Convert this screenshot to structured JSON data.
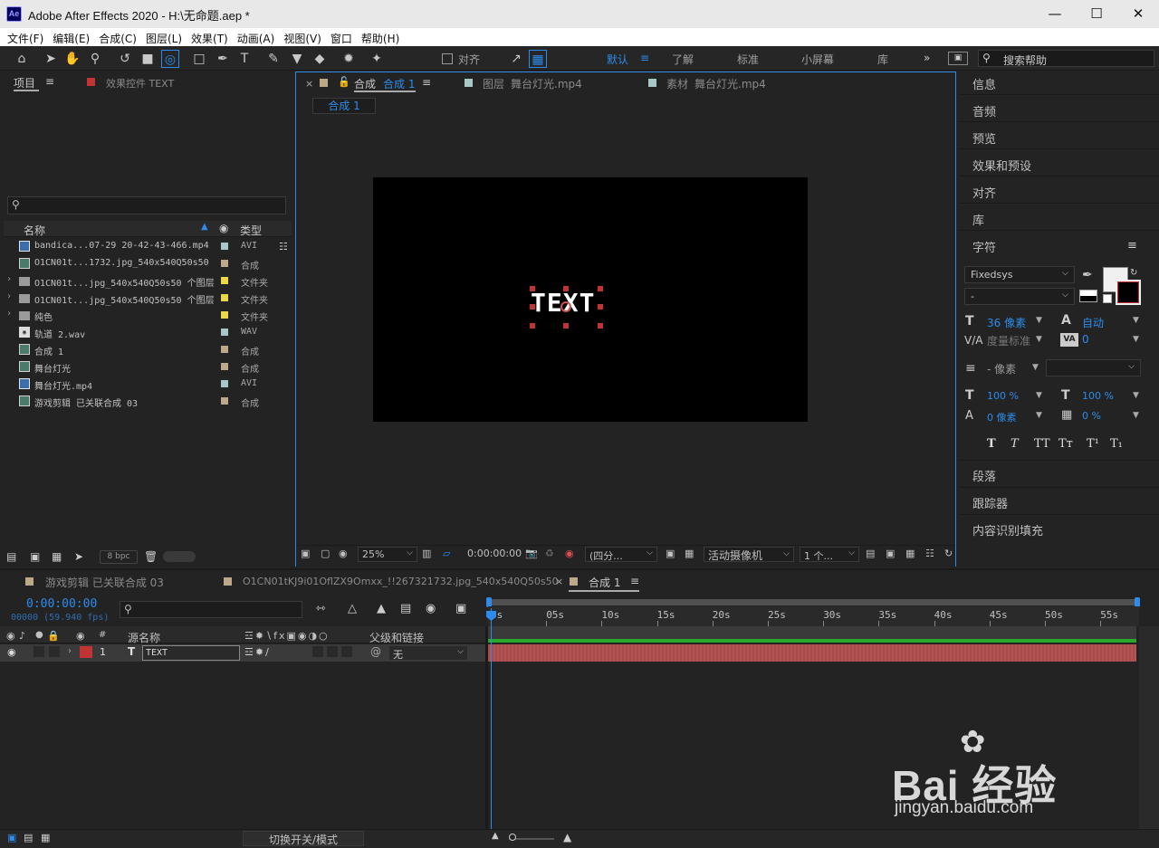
{
  "window": {
    "title": "Adobe After Effects 2020 - H:\\无命题.aep *",
    "logo": "Ae"
  },
  "menu": [
    "文件(F)",
    "编辑(E)",
    "合成(C)",
    "图层(L)",
    "效果(T)",
    "动画(A)",
    "视图(V)",
    "窗口",
    "帮助(H)"
  ],
  "toolbar": {
    "snap_label": "对齐",
    "workspaces": [
      "默认",
      "了解",
      "标准",
      "小屏幕",
      "库"
    ],
    "active_workspace": "默认",
    "search_placeholder": "搜索帮助"
  },
  "project_panel": {
    "tab": "项目",
    "effects_tab": "效果控件 TEXT",
    "search_placeholder": "",
    "col_name": "名称",
    "col_type": "类型",
    "bpc": "8 bpc",
    "items": [
      {
        "name": "bandica...07-29 20-42-43-466.mp4",
        "type": "AVI",
        "color": "#a8c8c8",
        "icon": "video-icon"
      },
      {
        "name": "O1CN01t...1732.jpg_540x540Q50s50",
        "type": "合成",
        "color": "#bca98a",
        "icon": "composition-icon"
      },
      {
        "name": "O1CN01t...jpg_540x540Q50s50 个图层",
        "type": "文件夹",
        "color": "#e8d84a",
        "icon": "folder-icon",
        "folder": true
      },
      {
        "name": "O1CN01t...jpg_540x540Q50s50 个图层",
        "type": "文件夹",
        "color": "#e8d84a",
        "icon": "folder-icon",
        "folder": true
      },
      {
        "name": "纯色",
        "type": "文件夹",
        "color": "#e8d84a",
        "icon": "folder-icon",
        "folder": true
      },
      {
        "name": "轨道 2.wav",
        "type": "WAV",
        "color": "#a8c8c8",
        "icon": "audio-icon"
      },
      {
        "name": "合成 1",
        "type": "合成",
        "color": "#bca98a",
        "icon": "composition-icon"
      },
      {
        "name": "舞台灯光",
        "type": "合成",
        "color": "#bca98a",
        "icon": "composition-icon"
      },
      {
        "name": "舞台灯光.mp4",
        "type": "AVI",
        "color": "#a8c8c8",
        "icon": "video-icon"
      },
      {
        "name": "游戏剪辑 已关联合成 03",
        "type": "合成",
        "color": "#bca98a",
        "icon": "composition-icon"
      }
    ]
  },
  "comp_panel": {
    "tabs": [
      {
        "prefix": "合成",
        "name": "合成 1",
        "color": "#bca98a",
        "active": true
      },
      {
        "prefix": "图层",
        "name": "舞台灯光.mp4",
        "color": "#a8c8c8"
      },
      {
        "prefix": "素材",
        "name": "舞台灯光.mp4",
        "color": "#a8c8c8"
      }
    ],
    "breadcrumb": "合成 1",
    "canvas_text": "TEXT",
    "zoom": "25%",
    "timecode": "0:00:00:00",
    "resolution": "(四分...",
    "camera": "活动摄像机",
    "views": "1 个..."
  },
  "right_panel": {
    "items_top": [
      "信息",
      "音频",
      "预览",
      "效果和预设",
      "对齐",
      "库"
    ],
    "character": {
      "title": "字符",
      "font": "Fixedsys",
      "style": "-",
      "size": "36 像素",
      "leading": "自动",
      "kerning": "度量标准",
      "tracking": "0",
      "stroke": "- 像素",
      "vscale": "100 %",
      "hscale": "100 %",
      "baseline": "0 像素",
      "tsume": "0 %",
      "styles": [
        "T",
        "T",
        "TT",
        "Tт",
        "T¹",
        "T₁"
      ]
    },
    "items_bottom": [
      "段落",
      "跟踪器",
      "内容识别填充"
    ]
  },
  "timeline": {
    "tabs": [
      {
        "name": "游戏剪辑 已关联合成 03",
        "color": "#bca98a"
      },
      {
        "name": "O1CN01tKJ9i01OflZX9Omxx_!!267321732.jpg_540x540Q50s50",
        "color": "#bca98a"
      },
      {
        "name": "合成 1",
        "color": "#bca98a",
        "active": true
      }
    ],
    "timecode": "0:00:00:00",
    "fps": "00000 (59.940 fps)",
    "col_num": "#",
    "col_source": "源名称",
    "col_parent": "父级和链接",
    "ruler": [
      "0s",
      "05s",
      "10s",
      "15s",
      "20s",
      "25s",
      "30s",
      "35s",
      "40s",
      "45s",
      "50s",
      "55s"
    ],
    "layer": {
      "num": "1",
      "type": "T",
      "name": "TEXT",
      "parent": "无",
      "color": "#c03434"
    },
    "toggle_label": "切换开关/模式"
  },
  "watermark": {
    "brand": "Bai 经验",
    "url": "jingyan.baidu.com"
  }
}
